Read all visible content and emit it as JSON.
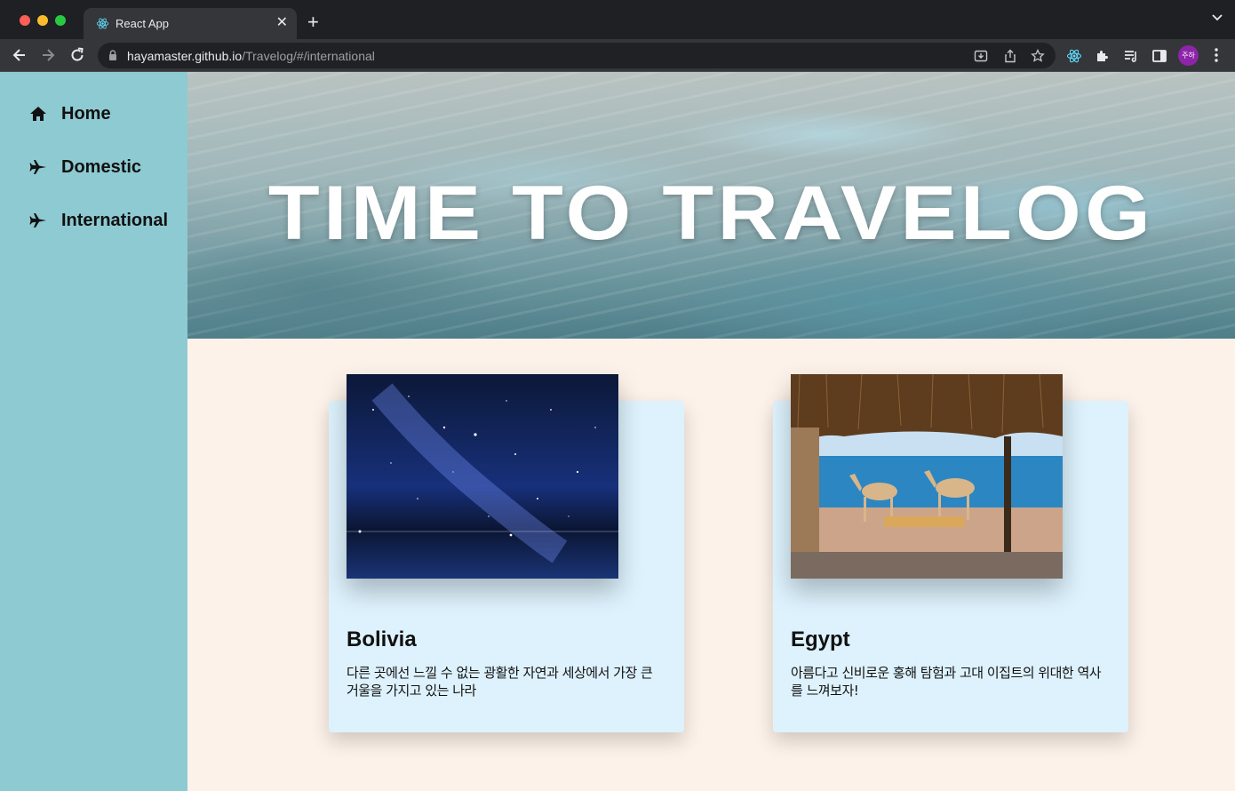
{
  "browser": {
    "tab_title": "React App",
    "url_host": "hayamaster.github.io",
    "url_path": "/Travelog/#/international",
    "profile_initials": "주하"
  },
  "sidebar": {
    "items": [
      {
        "label": "Home",
        "icon": "home-icon"
      },
      {
        "label": "Domestic",
        "icon": "airplane-icon"
      },
      {
        "label": "International",
        "icon": "airplane-icon"
      }
    ]
  },
  "hero": {
    "title": "TIME TO TRAVELOG"
  },
  "cards": [
    {
      "title": "Bolivia",
      "description": "다른 곳에선 느낄 수 없는 광활한 자연과 세상에서 가장 큰 거울을 가지고 있는 나라"
    },
    {
      "title": "Egypt",
      "description": "아름다고 신비로운 홍해 탐험과 고대 이집트의 위대한 역사를 느껴보자!"
    }
  ],
  "colors": {
    "sidebar_bg": "#8ecad2",
    "page_bg": "#fdf2e9",
    "card_bg": "#ddf2fd",
    "chrome_bg": "#35363a"
  }
}
